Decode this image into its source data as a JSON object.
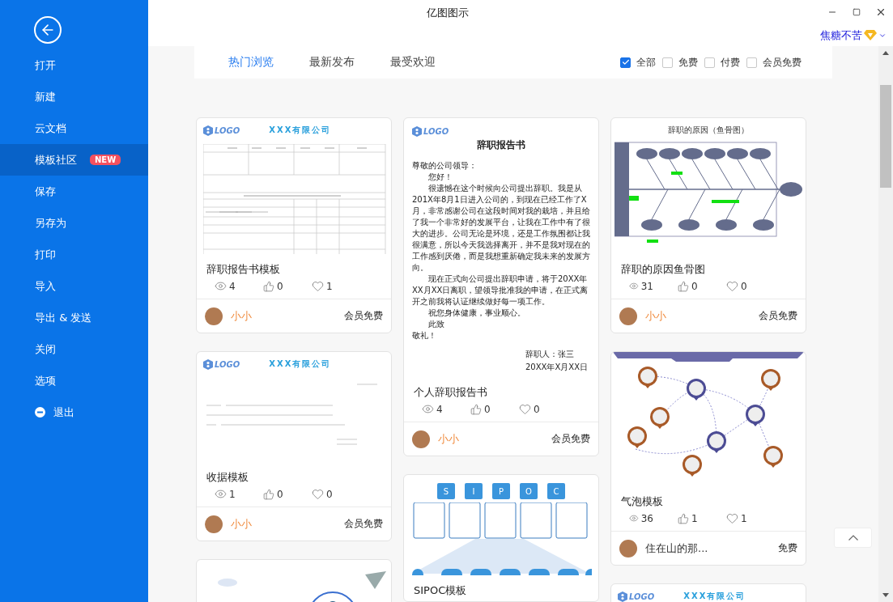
{
  "window": {
    "title": "亿图图示"
  },
  "user": {
    "name": "焦糖不苦"
  },
  "sidebar": {
    "items": [
      {
        "label": "打开",
        "selected": false,
        "kind": "plain"
      },
      {
        "label": "新建",
        "selected": false,
        "kind": "plain"
      },
      {
        "label": "云文档",
        "selected": false,
        "kind": "plain"
      },
      {
        "label": "模板社区",
        "selected": true,
        "kind": "plain",
        "badge": "NEW"
      },
      {
        "label": "保存",
        "selected": false,
        "kind": "plain"
      },
      {
        "label": "另存为",
        "selected": false,
        "kind": "plain"
      },
      {
        "label": "打印",
        "selected": false,
        "kind": "plain"
      },
      {
        "label": "导入",
        "selected": false,
        "kind": "plain"
      },
      {
        "label": "导出 & 发送",
        "selected": false,
        "kind": "plain"
      },
      {
        "label": "关闭",
        "selected": false,
        "kind": "plain"
      },
      {
        "label": "选项",
        "selected": false,
        "kind": "plain"
      },
      {
        "label": "退出",
        "selected": false,
        "kind": "exit"
      }
    ]
  },
  "tabs": [
    {
      "label": "热门浏览",
      "selected": true
    },
    {
      "label": "最新发布",
      "selected": false
    },
    {
      "label": "最受欢迎",
      "selected": false
    }
  ],
  "filters": [
    {
      "label": "全部",
      "checked": true
    },
    {
      "label": "免费",
      "checked": false
    },
    {
      "label": "付费",
      "checked": false
    },
    {
      "label": "会员免费",
      "checked": false
    }
  ],
  "columns": [
    [
      {
        "preview": {
          "kind": "form",
          "logo": "LOGO",
          "heading": "XXX有限公司"
        },
        "title": "辞职报告书模板",
        "views": "4",
        "likes": "0",
        "favorites": "1",
        "author": "小小",
        "color": "#f08a3c",
        "price": "会员免费"
      },
      {
        "preview": {
          "kind": "receipt",
          "logo": "LOGO",
          "heading": "XXX有限公司"
        },
        "title": "收据模板",
        "views": "1",
        "likes": "0",
        "favorites": "0",
        "author": "小小",
        "color": "#f08a3c",
        "price": "会员免费"
      },
      {
        "preview": {
          "kind": "illustration"
        }
      }
    ],
    [
      {
        "preview": {
          "kind": "letter",
          "logo": "LOGO",
          "heading": "辞职报告书",
          "lines": [
            "尊敬的公司领导：",
            "　　您好！",
            "　　很遗憾在这个时候向公司提出辞职。我是从201X年8月1日进入公司的，到现在已经工作了X月，非常感谢公司在这段时间对我的栽培，并且给了我一个非常好的发展平台，让我在工作中有了很大的进步。公司无论是环境，还是工作氛围都让我很满意，所以今天我选择离开，并不是我对现在的工作感到厌倦，而是我想重新确定我未来的发展方向。",
            "　　现在正式向公司提出辞职申请，将于20XX年XX月XX日离职，望领导批准我的申请，在正式离开之前我将认证继续做好每一项工作。",
            "　　祝您身体健康，事业顺心。",
            "　　此致",
            "敬礼！"
          ],
          "signature": [
            "辞职人：张三",
            "20XX年X月XX日"
          ]
        },
        "title": "个人辞职报告书",
        "views": "4",
        "likes": "0",
        "favorites": "0",
        "author": "小小",
        "color": "#f08a3c",
        "price": "会员免费"
      },
      {
        "preview": {
          "kind": "sipoc",
          "letters": [
            "S",
            "I",
            "P",
            "O",
            "C"
          ]
        },
        "title": "SIPOC模板"
      }
    ],
    [
      {
        "preview": {
          "kind": "fishbone",
          "heading": "辞职的原因（鱼骨图）"
        },
        "title": "辞职的原因鱼骨图",
        "views": "31",
        "likes": "0",
        "favorites": "0",
        "author": "小小",
        "color": "#f08a3c",
        "price": "会员免费"
      },
      {
        "preview": {
          "kind": "bubble"
        },
        "title": "气泡模板",
        "views": "36",
        "likes": "1",
        "favorites": "1",
        "author": "住在山的那...",
        "color": "#333333",
        "price": "免费"
      },
      {
        "preview": {
          "kind": "form",
          "logo": "LOGO",
          "heading": "XXX有限公司"
        }
      }
    ]
  ]
}
